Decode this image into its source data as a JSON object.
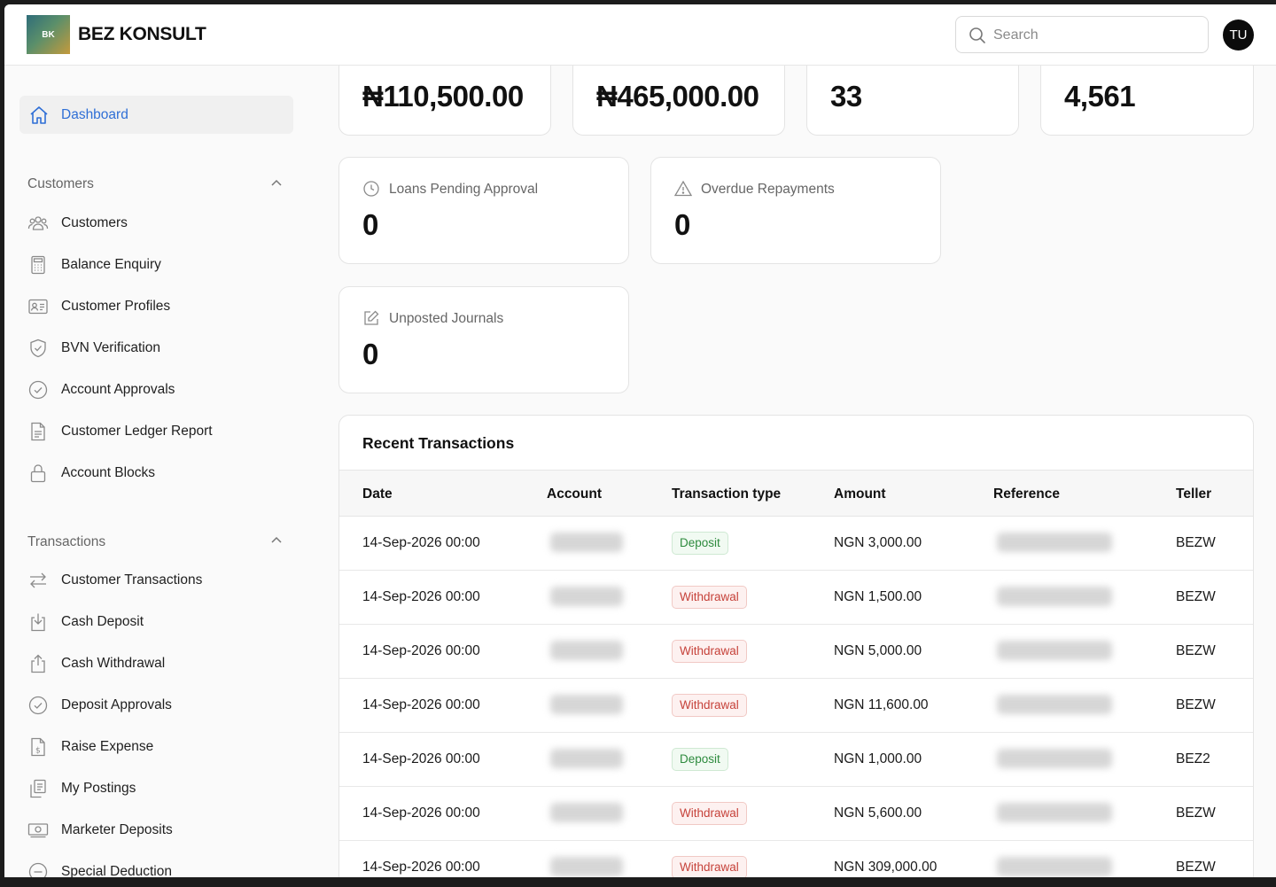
{
  "app": {
    "brand": "BEZ KONSULT",
    "logo_text": "BK"
  },
  "header": {
    "search_placeholder": "Search",
    "avatar_initials": "TU"
  },
  "sidebar": {
    "dashboard_label": "Dashboard",
    "customers_section": "Customers",
    "customers_items": [
      {
        "label": "Customers",
        "icon": "users-icon"
      },
      {
        "label": "Balance Enquiry",
        "icon": "calculator-icon"
      },
      {
        "label": "Customer Profiles",
        "icon": "id-card-icon"
      },
      {
        "label": "BVN Verification",
        "icon": "shield-check-icon"
      },
      {
        "label": "Account Approvals",
        "icon": "check-circle-icon"
      },
      {
        "label": "Customer Ledger Report",
        "icon": "document-icon"
      },
      {
        "label": "Account Blocks",
        "icon": "lock-icon"
      }
    ],
    "transactions_section": "Transactions",
    "transactions_items": [
      {
        "label": "Customer Transactions",
        "icon": "arrows-exchange-icon"
      },
      {
        "label": "Cash Deposit",
        "icon": "download-icon"
      },
      {
        "label": "Cash Withdrawal",
        "icon": "upload-icon"
      },
      {
        "label": "Deposit Approvals",
        "icon": "check-circle-icon"
      },
      {
        "label": "Raise Expense",
        "icon": "dollar-document-icon"
      },
      {
        "label": "My Postings",
        "icon": "clipboard-icon"
      },
      {
        "label": "Marketer Deposits",
        "icon": "cash-icon"
      },
      {
        "label": "Special Deduction",
        "icon": "minus-circle-icon"
      }
    ]
  },
  "stats": {
    "top": [
      "₦110,500.00",
      "₦465,000.00",
      "33",
      "4,561"
    ],
    "loans_pending": {
      "label": "Loans Pending Approval",
      "value": "0"
    },
    "overdue": {
      "label": "Overdue Repayments",
      "value": "0"
    },
    "unposted": {
      "label": "Unposted Journals",
      "value": "0"
    }
  },
  "transactions": {
    "title": "Recent Transactions",
    "columns": [
      "Date",
      "Account",
      "Transaction type",
      "Amount",
      "Reference",
      "Teller"
    ],
    "rows": [
      {
        "date": "14-Sep-2026 00:00",
        "type": "Deposit",
        "amount": "NGN 3,000.00",
        "teller": "BEZW"
      },
      {
        "date": "14-Sep-2026 00:00",
        "type": "Withdrawal",
        "amount": "NGN 1,500.00",
        "teller": "BEZW"
      },
      {
        "date": "14-Sep-2026 00:00",
        "type": "Withdrawal",
        "amount": "NGN 5,000.00",
        "teller": "BEZW"
      },
      {
        "date": "14-Sep-2026 00:00",
        "type": "Withdrawal",
        "amount": "NGN 11,600.00",
        "teller": "BEZW"
      },
      {
        "date": "14-Sep-2026 00:00",
        "type": "Deposit",
        "amount": "NGN 1,000.00",
        "teller": "BEZ2"
      },
      {
        "date": "14-Sep-2026 00:00",
        "type": "Withdrawal",
        "amount": "NGN 5,600.00",
        "teller": "BEZW"
      },
      {
        "date": "14-Sep-2026 00:00",
        "type": "Withdrawal",
        "amount": "NGN 309,000.00",
        "teller": "BEZW"
      }
    ]
  }
}
